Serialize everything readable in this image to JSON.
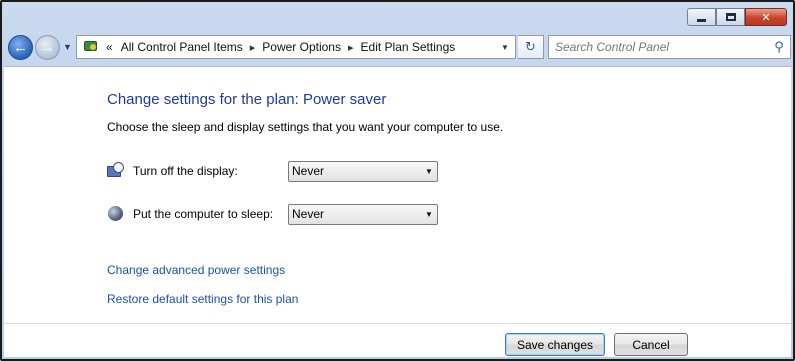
{
  "window": {
    "caption": {
      "minimize": "minimize-icon",
      "maximize": "maximize-icon",
      "close": "close-icon"
    }
  },
  "nav": {
    "back_icon": "back-arrow-icon",
    "forward_icon": "forward-arrow-icon",
    "breadcrumbs": [
      "All Control Panel Items",
      "Power Options",
      "Edit Plan Settings"
    ],
    "overflow": "«",
    "separator": "▸",
    "search_placeholder": "Search Control Panel"
  },
  "main": {
    "title": "Change settings for the plan: Power saver",
    "description": "Choose the sleep and display settings that you want your computer to use.",
    "settings": [
      {
        "label": "Turn off the display:",
        "value": "Never",
        "icon": "display-timer-icon"
      },
      {
        "label": "Put the computer to sleep:",
        "value": "Never",
        "icon": "sleep-moon-icon"
      }
    ],
    "links": {
      "advanced": "Change advanced power settings",
      "restore": "Restore default settings for this plan"
    },
    "buttons": {
      "save": "Save changes",
      "cancel": "Cancel"
    }
  },
  "colors": {
    "title": "#1e3a9a",
    "link": "#1a4fa8",
    "close_button": "#c7452a"
  }
}
